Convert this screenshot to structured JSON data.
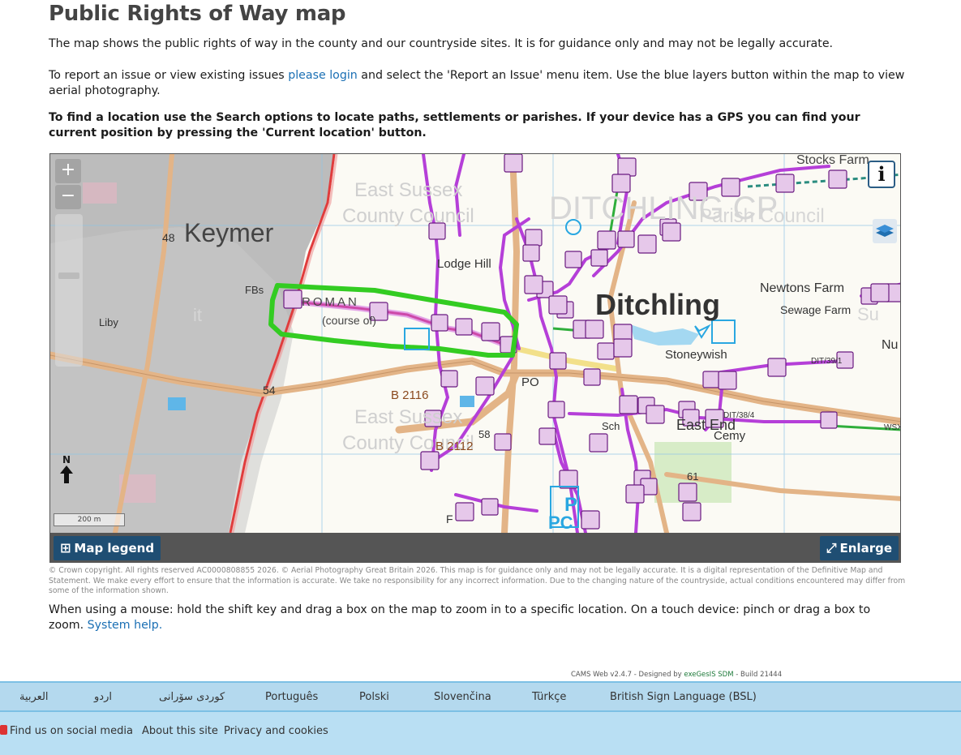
{
  "page": {
    "title": "Public Rights of Way map",
    "intro": "The map shows the public rights of way in the county and our countryside sites. It is for guidance only and may not be legally accurate.",
    "report_before": "To report an issue or view existing issues ",
    "report_link": "please login",
    "report_after": " and select the 'Report an Issue' menu item. Use the blue layers button within the map to view aerial photography.",
    "search_tip": "To find a location use the Search options to locate paths, settlements or parishes. If your device has a GPS you can find your current position by pressing the 'Current location' button."
  },
  "map": {
    "zoom_in": "+",
    "zoom_out": "−",
    "info": "i",
    "north": "N",
    "scale": "200 m",
    "legend_label": "Map legend",
    "enlarge_label": "Enlarge",
    "labels": {
      "stocks_farm": "Stocks Farm",
      "east_sussex_1": "East Sussex",
      "county_council_1": "County Council",
      "ditchling_cp": "DITCHLING CP",
      "parish_council": "Parish Council",
      "keymer": "Keymer",
      "num_48": "48",
      "lodge_hill": "Lodge Hill",
      "newtons_farm": "Newtons Farm",
      "sewage_farm": "Sewage Farm",
      "roman": "ROMAN",
      "course_of": "(course of)",
      "ditchling": "Ditchling",
      "fbs": "FBs",
      "liby": "Liby",
      "stoneywish": "Stoneywish",
      "num_54": "54",
      "b2116": "B 2116",
      "po": "PO",
      "east_sussex_2": "East Sussex",
      "county_council_2": "County Council",
      "b2112": "B 2112",
      "num_58": "58",
      "sch": "Sch",
      "east_end": "East End",
      "cemy": "Cemy",
      "p": "P",
      "pc": "PC",
      "num_61": "61",
      "f": "F",
      "dit_39_1": "DIT/39/1",
      "dit_38_4": "DIT/38/4",
      "wsx": "WSX",
      "nu": "Nu",
      "su": "Su",
      "it": "it"
    }
  },
  "disclaimer": "© Crown copyright. All rights reserved AC0000808855 2026. © Aerial Photography Great Britain 2026. This map is for guidance only and may not be legally accurate. It is a digital representation of the Definitive Map and Statement. We make every effort to ensure that the information is accurate. We take no responsibility for any incorrect information. Due to the changing nature of the countryside, actual conditions encountered may differ from some of the information shown.",
  "help": {
    "text": "When using a mouse: hold the shift key and drag a box on the map to zoom in to a specific location. On a touch device: pinch or drag a box to zoom. ",
    "link": "System help."
  },
  "build": {
    "prefix": "CAMS Web v2.4.7 - Designed by ",
    "company": "exeGesIS SDM",
    "suffix": " - Build 21444"
  },
  "languages": [
    "العربية",
    "اردو",
    "کوردی سۆرانی",
    "Português",
    "Polski",
    "Slovenčina",
    "Türkçe",
    "British Sign Language (BSL)"
  ],
  "footer": {
    "social": "Find us on social media",
    "about": "About this site",
    "privacy": "Privacy and cookies"
  },
  "colors": {
    "rights_of_way": "#b53fd8",
    "highlight": "#33cc22",
    "parish_boundary": "#e03c3c",
    "marker_fill": "#e6c8ea",
    "link": "#1a6fb4",
    "map_bar": "#555555",
    "button": "#1f4e73",
    "lang_bar": "#b4d9ee"
  }
}
